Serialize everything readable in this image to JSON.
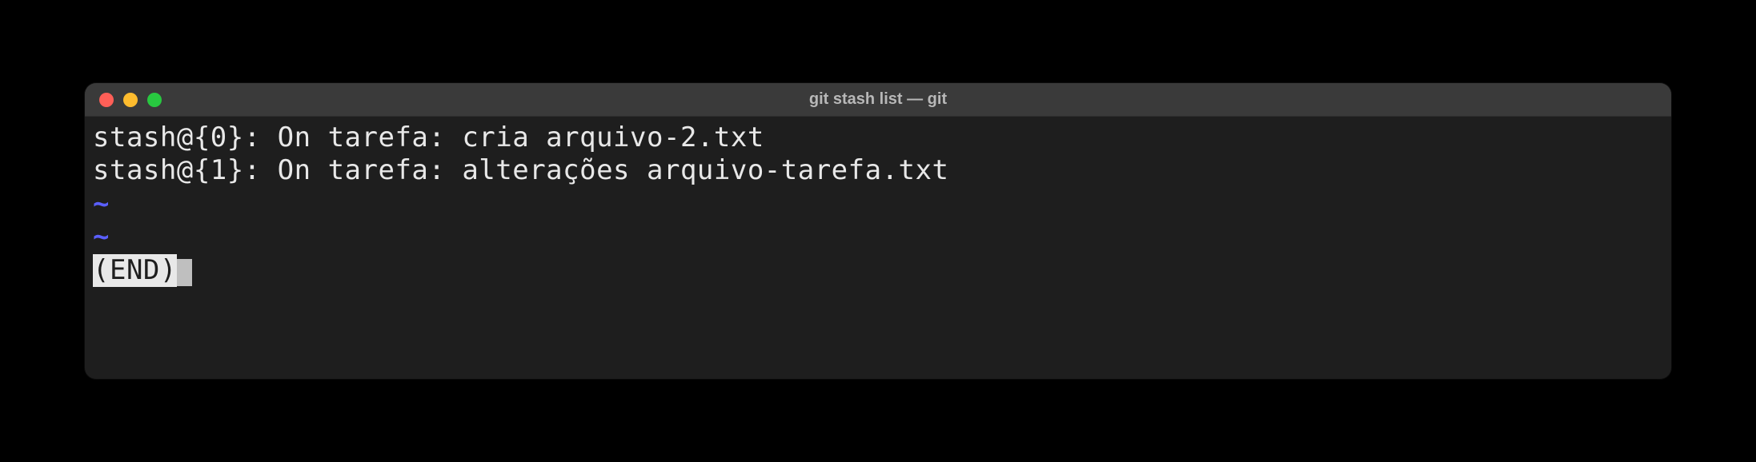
{
  "window": {
    "title": "git stash list — git"
  },
  "terminal": {
    "lines": [
      "stash@{0}: On tarefa: cria arquivo-2.txt",
      "stash@{1}: On tarefa: alterações arquivo-tarefa.txt"
    ],
    "tilde1": "~",
    "tilde2": "~",
    "end_marker": "(END)"
  }
}
